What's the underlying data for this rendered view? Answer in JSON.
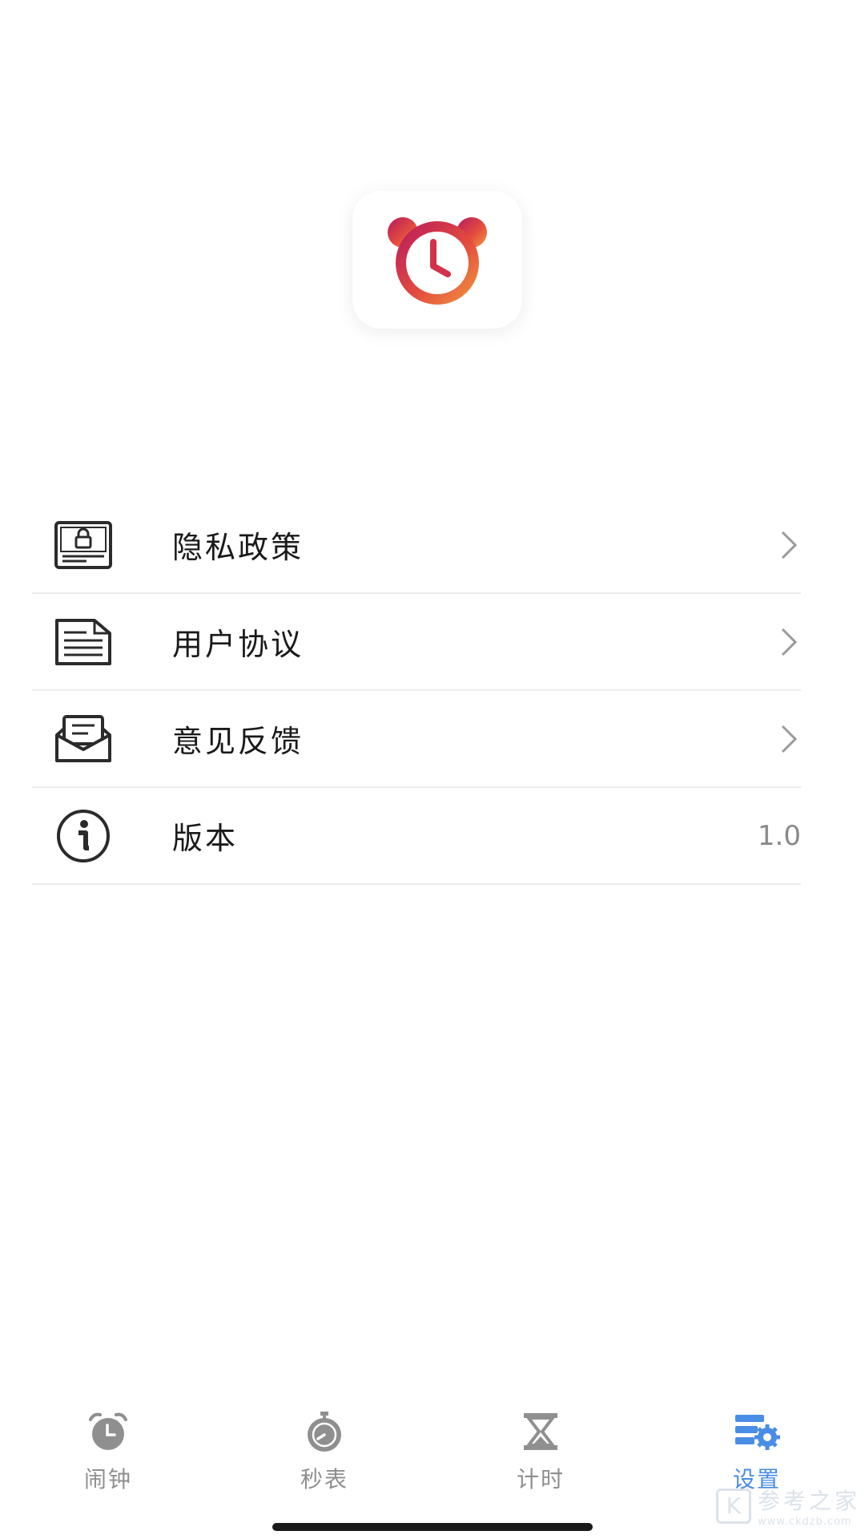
{
  "app": {
    "logo_icon": "alarm-clock-logo-icon"
  },
  "menu": {
    "items": [
      {
        "label": "隐私政策",
        "icon": "privacy-lock-document-icon",
        "trailing": "chevron-right-icon"
      },
      {
        "label": "用户协议",
        "icon": "document-lines-icon",
        "trailing": "chevron-right-icon"
      },
      {
        "label": "意见反馈",
        "icon": "mail-envelope-icon",
        "trailing": "chevron-right-icon"
      },
      {
        "label": "版本",
        "icon": "info-circle-icon",
        "value": "1.0"
      }
    ]
  },
  "tabbar": {
    "tabs": [
      {
        "label": "闹钟",
        "icon": "alarm-clock-icon",
        "active": false
      },
      {
        "label": "秒表",
        "icon": "stopwatch-icon",
        "active": false
      },
      {
        "label": "计时",
        "icon": "hourglass-icon",
        "active": false
      },
      {
        "label": "设置",
        "icon": "settings-gear-icon",
        "active": true
      }
    ]
  },
  "colors": {
    "accent": "#4a8de6",
    "inactive_tab": "#8f8f8f",
    "logo_gradient_start": "#c2185b",
    "logo_gradient_end": "#f08a3c"
  },
  "watermark": {
    "k": "K",
    "text": "参考之家",
    "url": "www.ckdzb.com"
  }
}
